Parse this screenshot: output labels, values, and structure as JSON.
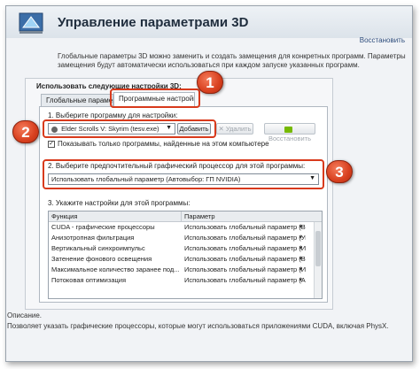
{
  "header": {
    "title": "Управление параметрами 3D",
    "restore_label": "Восстановить",
    "description": "Глобальные параметры 3D можно заменить и создать замещения для конкретных программ. Параметры замещения будут автоматически использоваться при каждом запуске указанных программ."
  },
  "panel": {
    "heading": "Использовать следующие настройки 3D:",
    "tabs": [
      {
        "label": "Глобальные параметры"
      },
      {
        "label": "Программные настройки"
      }
    ]
  },
  "step1": {
    "label": "1. Выберите программу для настройки:",
    "selected_program": "Elder Scrolls V: Skyrim (tesv.exe)",
    "add_label": "Добавить",
    "remove_label": "Удалить",
    "restore_label": "Восстановить"
  },
  "show_only": {
    "label": "Показывать только программы, найденные на этом компьютере",
    "checked": true
  },
  "step2": {
    "label": "2. Выберите предпочтительный графический процессор для этой программы:",
    "value": "Использовать глобальный параметр (Автовыбор: ГП NVIDIA)"
  },
  "step3": {
    "label": "3. Укажите настройки для этой программы:",
    "columns": [
      "Функция",
      "Параметр"
    ],
    "rows": [
      {
        "feature": "CUDA - графические процессоры",
        "value": "Использовать глобальный параметр (Все)"
      },
      {
        "feature": "Анизотропная фильтрация",
        "value": "Использовать глобальный параметр (Упр..."
      },
      {
        "feature": "Вертикальный синхроимпульс",
        "value": "Использовать глобальный параметр (Исп..."
      },
      {
        "feature": "Затенение фонового освещения",
        "value": "Использовать глобальный параметр (Вык..."
      },
      {
        "feature": "Максимальное количество заранее под...",
        "value": "Использовать глобальный параметр (Исп..."
      },
      {
        "feature": "Потоковая оптимизация",
        "value": "Использовать глобальный параметр (Авто)"
      }
    ]
  },
  "description_area": {
    "label": "Описание.",
    "text": "Позволяет указать графические процессоры, которые могут использоваться приложениями CUDA, включая PhysX."
  },
  "callouts": {
    "badge1": "1",
    "badge2": "2",
    "badge3": "3"
  },
  "colors": {
    "callout": "#d83a1c",
    "nvidia_green": "#76b900"
  }
}
